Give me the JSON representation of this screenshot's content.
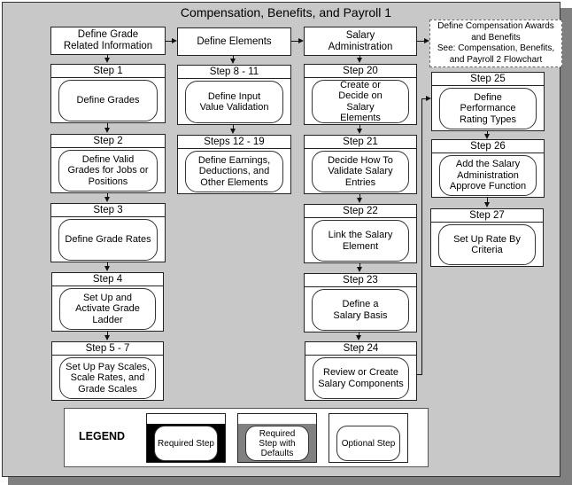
{
  "title": "Compensation, Benefits, and Payroll 1",
  "headers": {
    "grade": "Define Grade Related Information",
    "elements": "Define Elements",
    "salary": "Salary Administration",
    "external": "Define Compensation Awards and Benefits See: Compensation, Benefits, and Payroll 2 Flowchart"
  },
  "external_lines": [
    "Define Compensation Awards",
    "and Benefits",
    "See: Compensation, Benefits,",
    "and Payroll 2 Flowchart"
  ],
  "grade_header_lines": [
    "Define Grade",
    "Related Information"
  ],
  "salary_header_lines": [
    "Salary",
    "Administration"
  ],
  "columns": {
    "grade": [
      {
        "step": "Step 1",
        "text": "Define Grades",
        "type": "optional"
      },
      {
        "step": "Step 2",
        "text": "Define Valid Grades for Jobs or Positions",
        "type": "optional"
      },
      {
        "step": "Step 3",
        "text": "Define Grade Rates",
        "type": "optional"
      },
      {
        "step": "Step 4",
        "text": "Set Up and Activate Grade Ladder",
        "type": "optional"
      },
      {
        "step": "Step 5 - 7",
        "text": "Set Up Pay Scales, Scale Rates, and Grade Scales",
        "type": "optional"
      }
    ],
    "elements": [
      {
        "step": "Step 8 - 11",
        "text": "Define Input Value Validation",
        "type": "optional"
      },
      {
        "step": "Steps 12 - 19",
        "text": "Define Earnings, Deductions, and Other Elements",
        "type": "optional"
      }
    ],
    "salary": [
      {
        "step": "Step 20",
        "text": "Create or Decide on Salary Elements",
        "type": "optional"
      },
      {
        "step": "Step 21",
        "text": "Decide How To Validate Salary Entries",
        "type": "optional"
      },
      {
        "step": "Step 22",
        "text": "Link the Salary Element",
        "type": "optional"
      },
      {
        "step": "Step 23",
        "text": "Define a Salary Basis",
        "type": "optional"
      },
      {
        "step": "Step 24",
        "text": "Review or Create Salary Components",
        "type": "optional"
      }
    ],
    "performance": [
      {
        "step": "Step 25",
        "text": "Define Performance Rating Types",
        "type": "optional"
      },
      {
        "step": "Step 26",
        "text": "Add the Salary Administration Approve Function",
        "type": "optional"
      },
      {
        "step": "Step 27",
        "text": "Set Up Rate By Criteria",
        "type": "optional"
      }
    ]
  },
  "legend": {
    "title": "LEGEND",
    "items": [
      {
        "label": "Required Step",
        "fill": "#000000"
      },
      {
        "label": "Required Step with Defaults",
        "fill": "#808080"
      },
      {
        "label": "Optional Step",
        "fill": "#ffffff"
      }
    ]
  }
}
